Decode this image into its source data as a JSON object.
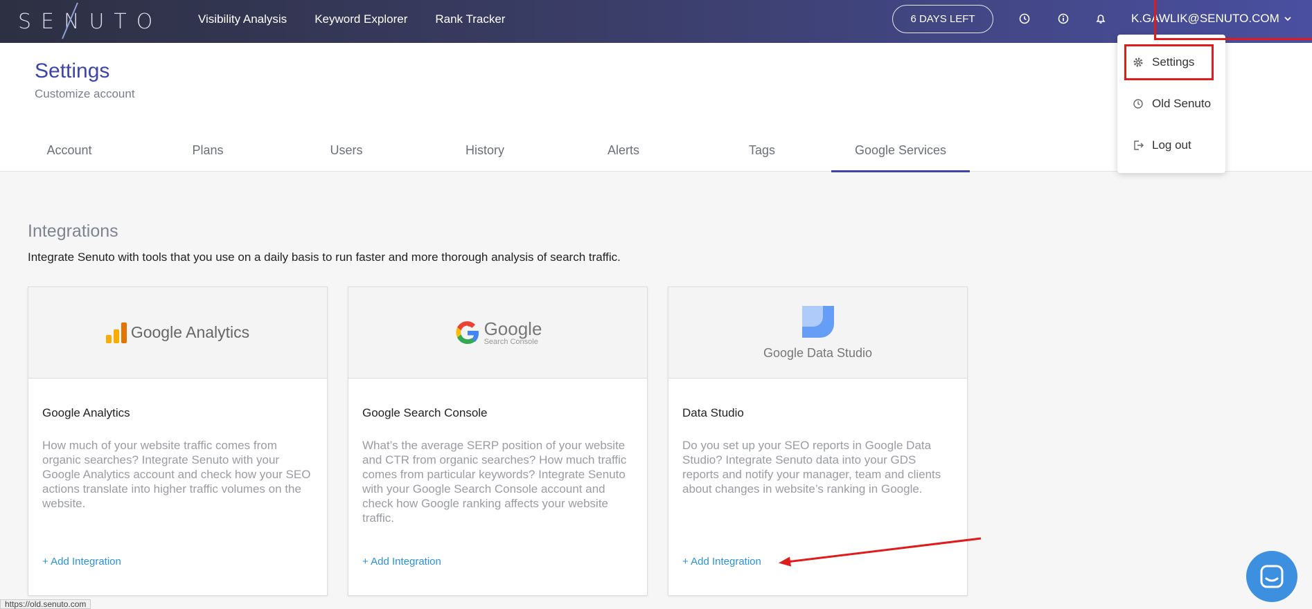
{
  "app": {
    "logo_text": "SENUTO",
    "nav": [
      "Visibility Analysis",
      "Keyword Explorer",
      "Rank Tracker"
    ],
    "days_left": "6 DAYS LEFT",
    "user_email": "K.GAWLIK@SENUTO.COM"
  },
  "dropdown": {
    "items": [
      {
        "label": "Settings",
        "icon": "gear-icon"
      },
      {
        "label": "Old Senuto",
        "icon": "history-icon"
      },
      {
        "label": "Log out",
        "icon": "logout-icon"
      }
    ]
  },
  "page": {
    "title": "Settings",
    "subtitle": "Customize account",
    "tabs": [
      "Account",
      "Plans",
      "Users",
      "History",
      "Alerts",
      "Tags",
      "Google Services"
    ],
    "active_tab": "Google Services"
  },
  "integrations": {
    "title": "Integrations",
    "description": "Integrate Senuto with tools that you use on a daily basis to run faster and more thorough analysis of search traffic.",
    "cards": [
      {
        "logo_text": "Google Analytics",
        "title": "Google Analytics",
        "text": "How much of your website traffic comes from organic searches? Integrate Senuto with your Google Analytics account and check how your SEO actions translate into higher traffic volumes on the website.",
        "link": "+ Add Integration"
      },
      {
        "logo_text": "Google",
        "logo_sub": "Search Console",
        "title": "Google Search Console",
        "text": "What’s the average SERP position of your website and CTR from organic searches? How much traffic comes from particular keywords? Integrate Senuto with your Google Search Console account and check how Google ranking affects your website traffic.",
        "link": "+ Add Integration"
      },
      {
        "logo_text": "Google Data Studio",
        "title": "Data Studio",
        "text": "Do you set up your SEO reports in Google Data Studio? Integrate Senuto data into your GDS reports and notify your manager, team and clients about changes in website’s ranking in Google.",
        "link": "+ Add Integration"
      }
    ]
  },
  "status_bar": {
    "url": "https://old.senuto.com"
  },
  "colors": {
    "accent": "#3d45a8",
    "link": "#2a93d5",
    "annotation": "#e01b1b",
    "chat": "#3d8fe0"
  }
}
